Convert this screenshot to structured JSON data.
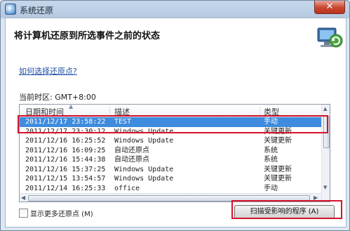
{
  "window": {
    "title": "系统还原",
    "close_glyph": "✕"
  },
  "page": {
    "heading": "将计算机还原到所选事件之前的状态",
    "help_link": "如何选择还原点?",
    "timezone": "当前时区: GMT+8:00"
  },
  "list": {
    "columns": {
      "date": "日期和时间",
      "description": "描述",
      "type": "类型"
    },
    "rows": [
      {
        "date": "2011/12/17 23:58:22",
        "description": "TEST",
        "type": "手动"
      },
      {
        "date": "2011/12/17 23:30:12",
        "description": "Windows Update",
        "type": "关键更新"
      },
      {
        "date": "2011/12/16 16:25:52",
        "description": "Windows Update",
        "type": "关键更新"
      },
      {
        "date": "2011/12/16 16:09:25",
        "description": "自动还原点",
        "type": "系统"
      },
      {
        "date": "2011/12/16 15:44:38",
        "description": "自动还原点",
        "type": "系统"
      },
      {
        "date": "2011/12/16 15:37:25",
        "description": "Windows Update",
        "type": "关键更新"
      },
      {
        "date": "2011/12/15 13:54:57",
        "description": "Windows Update",
        "type": "关键更新"
      },
      {
        "date": "2011/12/14 16:25:33",
        "description": "office",
        "type": "手动"
      }
    ],
    "selected_index": 0
  },
  "footer": {
    "show_more_label": "显示更多还原点 (M)",
    "scan_button": "扫描受影响的程序 (A)"
  },
  "colors": {
    "selection": "#3f8cde",
    "annotation": "#d6132c"
  }
}
